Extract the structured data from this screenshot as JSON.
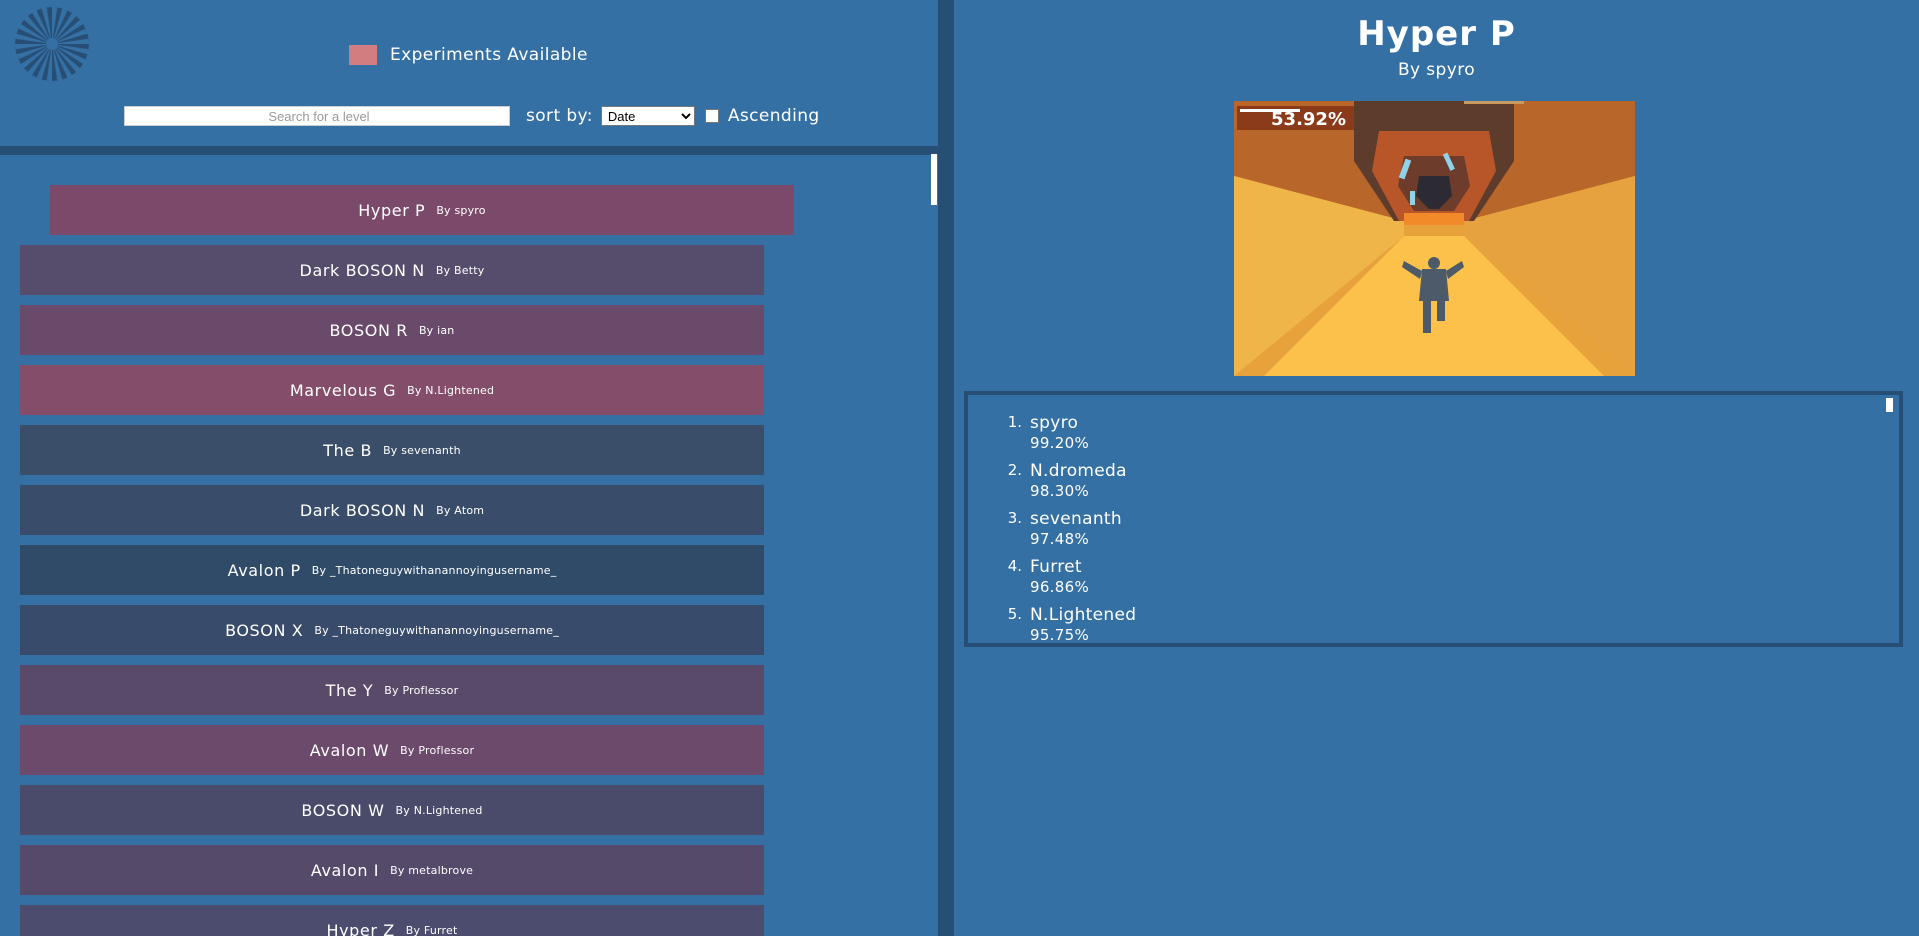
{
  "header": {
    "legend_label": "Experiments Available",
    "legend_color": "#d27d7f",
    "search_placeholder": "Search for a level",
    "sort_label": "sort by:",
    "sort_value": "Date",
    "ascending_label": "Ascending",
    "ascending_checked": false
  },
  "levels": [
    {
      "name": "Hyper P",
      "by": "By spyro",
      "color": "#7b4a6a",
      "selected": true
    },
    {
      "name": "Dark BOSON N",
      "by": "By Betty",
      "color": "#564c6c",
      "selected": false
    },
    {
      "name": "BOSON R",
      "by": "By ian",
      "color": "#6a4a6a",
      "selected": false
    },
    {
      "name": "Marvelous G",
      "by": "By N.Lightened",
      "color": "#844e6a",
      "selected": false
    },
    {
      "name": "The B",
      "by": "By sevenanth",
      "color": "#3a4e6a",
      "selected": false
    },
    {
      "name": "Dark BOSON N",
      "by": "By Atom",
      "color": "#394d6b",
      "selected": false
    },
    {
      "name": "Avalon P",
      "by": "By _Thatoneguywithanannoyingusername_",
      "color": "#2f4b68",
      "selected": false
    },
    {
      "name": "BOSON X",
      "by": "By _Thatoneguywithanannoyingusername_",
      "color": "#394b6b",
      "selected": false
    },
    {
      "name": "The Y",
      "by": "By Proflessor",
      "color": "#5a4a6a",
      "selected": false
    },
    {
      "name": "Avalon W",
      "by": "By Proflessor",
      "color": "#6b4a6b",
      "selected": false
    },
    {
      "name": "BOSON W",
      "by": "By N.Lightened",
      "color": "#4a4a6b",
      "selected": false
    },
    {
      "name": "Avalon I",
      "by": "By metalbrove",
      "color": "#554a6a",
      "selected": false
    },
    {
      "name": "Hyper Z",
      "by": "By Furret",
      "color": "#4b4c6e",
      "selected": false
    }
  ],
  "detail": {
    "title": "Hyper P",
    "author": "By spyro",
    "progress_text": "53.92%",
    "progress_value": 53.92,
    "leaderboard": [
      {
        "rank": "1.",
        "name": "spyro",
        "score": "99.20%"
      },
      {
        "rank": "2.",
        "name": "N.dromeda",
        "score": "98.30%"
      },
      {
        "rank": "3.",
        "name": "sevenanth",
        "score": "97.48%"
      },
      {
        "rank": "4.",
        "name": "Furret",
        "score": "96.86%"
      },
      {
        "rank": "5.",
        "name": "N.Lightened",
        "score": "95.75%"
      }
    ]
  },
  "icons": {
    "logo": "burst-logo-icon",
    "dropdown": "chevron-down-icon"
  }
}
